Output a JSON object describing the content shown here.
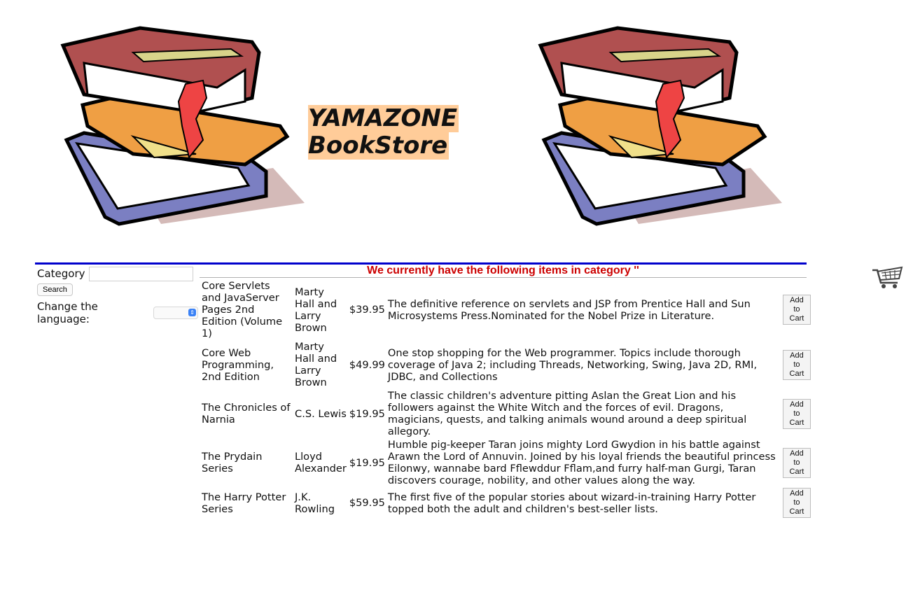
{
  "header": {
    "title_line1": "YAMAZONE",
    "title_line2": "BookStore"
  },
  "sidebar": {
    "category_label": "Category",
    "category_value": "",
    "search_label": "Search",
    "language_label": "Change the language:",
    "language_value": ""
  },
  "main": {
    "heading": "We currently have the following items in category ''",
    "items": [
      {
        "title": "Core Servlets and JavaServer Pages 2nd Edition (Volume 1)",
        "author": "Marty Hall and Larry Brown",
        "price": "$39.95",
        "description": "The definitive reference on servlets and JSP from Prentice Hall and Sun Microsystems Press.Nominated for the Nobel Prize in Literature.",
        "button": "Add to Cart"
      },
      {
        "title": "Core Web Programming, 2nd Edition",
        "author": "Marty Hall and Larry Brown",
        "price": "$49.99",
        "description": "One stop shopping for the Web programmer. Topics include thorough coverage of Java 2; including Threads, Networking, Swing, Java 2D, RMI, JDBC, and Collections",
        "button": "Add to Cart"
      },
      {
        "title": "The Chronicles of Narnia",
        "author": "C.S. Lewis",
        "price": "$19.95",
        "description": "The classic children's adventure pitting Aslan the Great Lion and his followers against the White Witch and the forces of evil. Dragons, magicians, quests, and talking animals wound around a deep spiritual allegory.",
        "button": "Add to Cart"
      },
      {
        "title": "The Prydain Series",
        "author": "Lloyd Alexander",
        "price": "$19.95",
        "description": "Humble pig-keeper Taran joins mighty Lord Gwydion in his battle against Arawn the Lord of Annuvin. Joined by his loyal friends the beautiful princess Eilonwy, wannabe bard Fflewddur Fflam,and furry half-man Gurgi, Taran discovers courage, nobility, and other values along the way.",
        "button": "Add to Cart"
      },
      {
        "title": "The Harry Potter Series",
        "author": "J.K. Rowling",
        "price": "$59.95",
        "description": "The first five of the popular stories about wizard-in-training Harry Potter topped both the adult and children's best-seller lists.",
        "button": "Add to Cart"
      }
    ]
  },
  "colors": {
    "title_bg": "#ffcc99",
    "heading": "#cc0000",
    "rule": "#0000cc"
  }
}
